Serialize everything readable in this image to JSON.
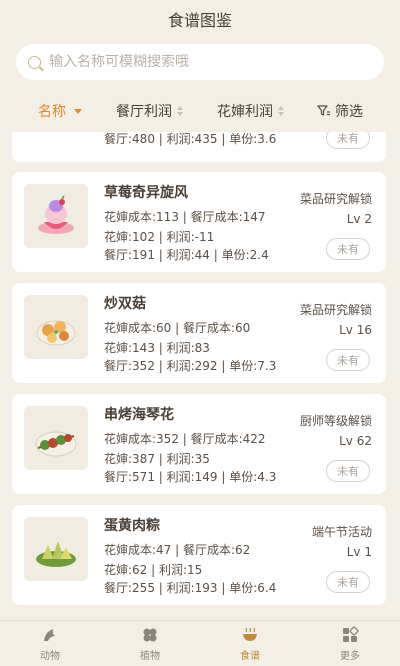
{
  "header": {
    "title": "食谱图鉴"
  },
  "search": {
    "placeholder": "输入名称可模糊搜索哦"
  },
  "sortbar": {
    "name_label": "名称",
    "restaurant_profit_label": "餐厅利润",
    "flower_profit_label": "花婶利润",
    "filter_label": "筛选"
  },
  "partial_card": {
    "line3": "餐厅:480 | 利润:435 | 单份:3.6",
    "owned": "未有"
  },
  "recipes": [
    {
      "name": "草莓奇异旋风",
      "line1": "花婶成本:113 | 餐厅成本:147",
      "line2": "花婶:102 | 利润:-11",
      "line3": "餐厅:191 | 利润:44 | 单份:2.4",
      "unlock": "菜品研究解锁",
      "level": "Lv 2",
      "owned": "未有"
    },
    {
      "name": "炒双菇",
      "line1": "花婶成本:60 | 餐厅成本:60",
      "line2": "花婶:143 | 利润:83",
      "line3": "餐厅:352 | 利润:292 | 单份:7.3",
      "unlock": "菜品研究解锁",
      "level": "Lv 16",
      "owned": "未有"
    },
    {
      "name": "串烤海琴花",
      "line1": "花婶成本:352 | 餐厅成本:422",
      "line2": "花婶:387 | 利润:35",
      "line3": "餐厅:571 | 利润:149 | 单份:4.3",
      "unlock": "厨师等级解锁",
      "level": "Lv 62",
      "owned": "未有"
    },
    {
      "name": "蛋黄肉粽",
      "line1": "花婶成本:47 | 餐厅成本:62",
      "line2": "花婶:62 | 利润:15",
      "line3": "餐厅:255 | 利润:193 | 单份:6.4",
      "unlock": "端午节活动",
      "level": "Lv 1",
      "owned": "未有"
    }
  ],
  "tabs": [
    {
      "label": "动物"
    },
    {
      "label": "植物"
    },
    {
      "label": "食谱"
    },
    {
      "label": "更多"
    }
  ],
  "colors": {
    "accent": "#e8862f",
    "active_tab": "#c08a3c",
    "background": "#f3efe6"
  }
}
